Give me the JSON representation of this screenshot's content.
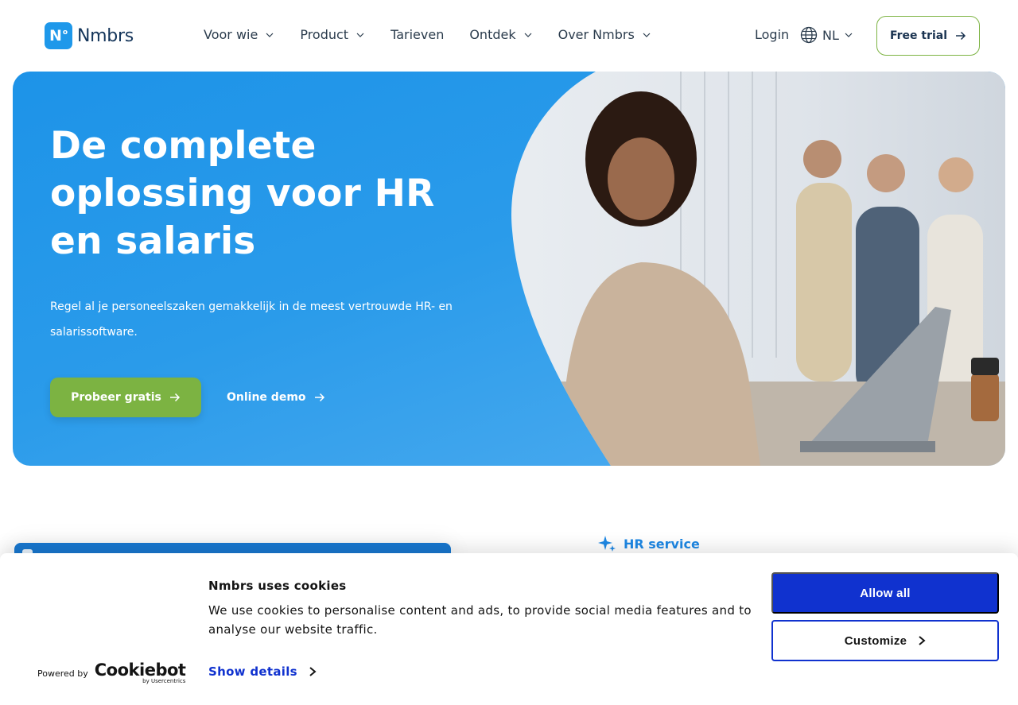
{
  "brand": {
    "logo_mark": "N",
    "logo_name": "Nmbrs"
  },
  "nav": {
    "items": [
      {
        "label": "Voor wie",
        "dropdown": true
      },
      {
        "label": "Product",
        "dropdown": true
      },
      {
        "label": "Tarieven",
        "dropdown": false
      },
      {
        "label": "Ontdek",
        "dropdown": true
      },
      {
        "label": "Over Nmbrs",
        "dropdown": true
      }
    ],
    "login": "Login",
    "language": "NL",
    "trial_button": "Free trial"
  },
  "hero": {
    "title": "De complete oplossing voor HR en salaris",
    "subtitle": "Regel al je personeelszaken gemakkelijk in de meest vertrouwde HR- en salarissoftware.",
    "primary_button": "Probeer gratis",
    "secondary_link": "Online demo"
  },
  "section": {
    "eyebrow": "HR service"
  },
  "cookie_banner": {
    "title": "Nmbrs uses cookies",
    "text": "We use cookies to personalise content and ads, to provide social media features and to analyse our website traffic.",
    "details_link": "Show details",
    "powered_by": "Powered by",
    "provider_name": "Cookiebot",
    "provider_sub": "by Usercentrics",
    "allow_all": "Allow all",
    "customize": "Customize"
  },
  "colors": {
    "primary_blue": "#1e98ea",
    "accent_green": "#7cb342",
    "cookie_blue": "#1032cf"
  },
  "icons": [
    "chevron-down-icon",
    "globe-icon",
    "arrow-right-icon",
    "sparkle-icon",
    "chevron-right-icon"
  ]
}
